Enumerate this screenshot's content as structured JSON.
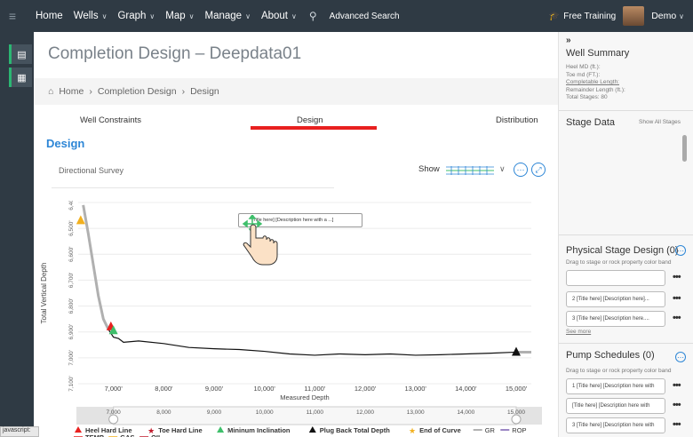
{
  "nav": {
    "items": [
      {
        "label": "Home",
        "chevron": false
      },
      {
        "label": "Wells",
        "chevron": true
      },
      {
        "label": "Graph",
        "chevron": true
      },
      {
        "label": "Map",
        "chevron": true
      },
      {
        "label": "Manage",
        "chevron": true
      },
      {
        "label": "About",
        "chevron": true
      }
    ],
    "advanced_search": "Advanced Search",
    "free_training": "Free Training",
    "user": "Demo"
  },
  "page": {
    "title": "Completion Design – Deepdata01",
    "breadcrumb": [
      "Home",
      "Completion Design",
      "Design"
    ],
    "tabs": [
      "Well Constraints",
      "Design",
      "Distribution"
    ],
    "section": "Design",
    "survey_label": "Directional Survey",
    "show_label": "Show"
  },
  "tooltip": "[Title here]  [Description here with a ...]",
  "chart_data": {
    "type": "line",
    "xlabel": "Measured Depth",
    "ylabel": "Total Vertical Depth",
    "x_ticks": [
      "7,000'",
      "8,000'",
      "9,000'",
      "10,000'",
      "11,000'",
      "12,000'",
      "13,000'",
      "14,000'",
      "15,000'"
    ],
    "y_ticks": [
      "6,400'",
      "6,500'",
      "6,600'",
      "6,700'",
      "6,800'",
      "6,900'",
      "7,000'",
      "7,100'"
    ],
    "xlim": [
      6300,
      15300
    ],
    "ylim": [
      6400,
      7100
    ],
    "series": [
      {
        "name": "Well",
        "x": [
          6400,
          6500,
          6600,
          6700,
          6800,
          6900,
          7000,
          7100,
          7200,
          7500,
          8000,
          8500,
          9000,
          9500,
          10000,
          10500,
          11000,
          11500,
          12000,
          12500,
          13000,
          13500,
          14000,
          14500,
          15000,
          15300
        ],
        "y": [
          6410,
          6520,
          6640,
          6760,
          6850,
          6890,
          6920,
          6925,
          6940,
          6935,
          6945,
          6960,
          6965,
          6968,
          6975,
          6985,
          6990,
          6985,
          6988,
          6985,
          6990,
          6988,
          6985,
          6982,
          6978,
          6978
        ]
      }
    ],
    "markers": [
      {
        "label": "Heel Hard Line",
        "x": 6950,
        "y": 6880,
        "color": "#e8201f",
        "shape": "triangle"
      },
      {
        "label": "Mininum Inclination",
        "x": 7000,
        "y": 6895,
        "color": "#3fbf6b",
        "shape": "triangle"
      },
      {
        "label": "Plug Back Total Depth",
        "x": 15000,
        "y": 6978,
        "color": "#111111",
        "shape": "triangle"
      },
      {
        "label": "End of Curve",
        "x": 6350,
        "y": 6470,
        "color": "#f2b01e",
        "shape": "triangle"
      }
    ],
    "range_ticks": [
      "7,000",
      "8,000",
      "9,000",
      "10,000",
      "11,000",
      "12,000",
      "13,000",
      "14,000",
      "15,000"
    ],
    "legend": [
      {
        "label": "Heel Hard Line",
        "color": "#e8201f",
        "kind": "triangle"
      },
      {
        "label": "Toe Hard Line",
        "color": "#c0182a",
        "kind": "star"
      },
      {
        "label": "Mininum Inclination",
        "color": "#3fbf6b",
        "kind": "triangle"
      },
      {
        "label": "Plug Back Total Depth",
        "color": "#111111",
        "kind": "triangle"
      },
      {
        "label": "End of Curve",
        "color": "#f2b01e",
        "kind": "star"
      },
      {
        "label": "GR",
        "color": "#999999",
        "kind": "line"
      },
      {
        "label": "ROP",
        "color": "#7a5fb0",
        "kind": "line"
      },
      {
        "label": "TEMP",
        "color": "#e8201f",
        "kind": "line"
      },
      {
        "label": "GAS",
        "color": "#f2b01e",
        "kind": "line"
      },
      {
        "label": "OIL",
        "color": "#c0182a",
        "kind": "line"
      }
    ]
  },
  "right": {
    "well_summary_title": "Well Summary",
    "summary_lines": [
      "Heel MD (ft.):",
      "Toe md (FT.):",
      "Completable Length:",
      "Remainder Length (ft.):",
      "Total Stages: 80"
    ],
    "stage_data": "Stage Data",
    "show_all": "Show All Stages",
    "physical_title": "Physical Stage Design (0)",
    "physical_hint": "Drag to stage or rock property color band",
    "physical_cards": [
      "",
      "2  [Title here]   [Description here]...",
      "3  [Title here]   [Description here...."
    ],
    "see_more": "See more",
    "pump_title": "Pump Schedules (0)",
    "pump_hint": "Drag to stage or rock property color band",
    "pump_cards": [
      "1  [Title here]   [Description here with",
      "   [Title here]   [Description here with",
      "3  [Title here]   [Description here with"
    ]
  },
  "status": "javascript:"
}
